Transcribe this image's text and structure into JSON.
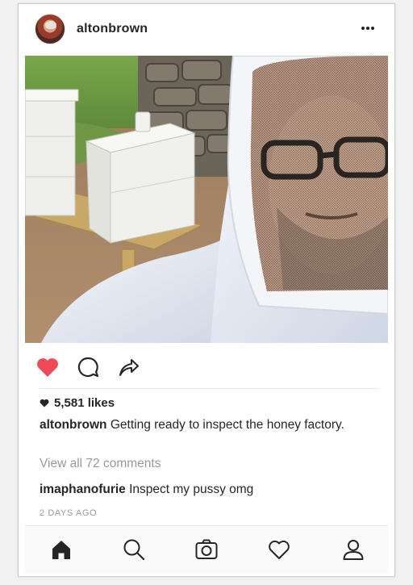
{
  "post": {
    "username": "altonbrown",
    "likes": "5,581 likes",
    "caption": {
      "author": "altonbrown",
      "text": "Getting ready to inspect the honey factory."
    },
    "view_comments": "View all 72 comments",
    "comment": {
      "author": "imaphanofurie",
      "text": "Inspect my pussy omg"
    },
    "timestamp": "2 DAYS AGO",
    "liked": true
  },
  "icons": {
    "more": "more-options-icon",
    "like": "heart-icon",
    "comment": "comment-icon",
    "share": "share-icon"
  },
  "bottom_nav": [
    "home-icon",
    "search-icon",
    "camera-icon",
    "heart-icon",
    "profile-icon"
  ],
  "colors": {
    "like_red": "#ed4956",
    "text": "#262626",
    "muted": "#999999"
  }
}
